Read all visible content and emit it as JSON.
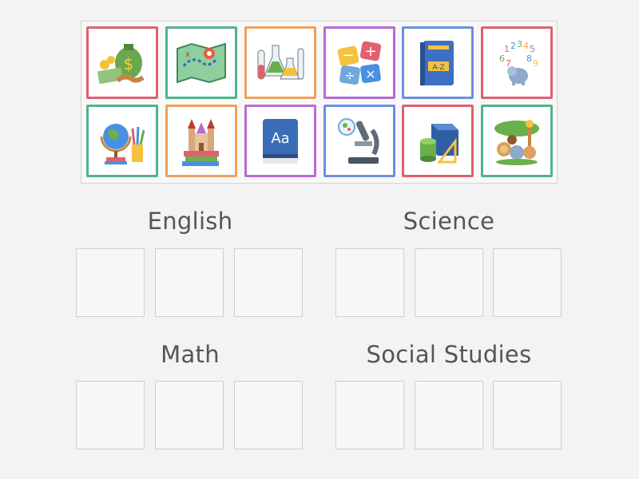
{
  "game": {
    "cards": [
      {
        "icon": "money-handshake-icon",
        "border": "#e06070"
      },
      {
        "icon": "treasure-map-icon",
        "border": "#4fb58a"
      },
      {
        "icon": "lab-flasks-icon",
        "border": "#f0a05a"
      },
      {
        "icon": "math-operators-icon",
        "border": "#b86ad6"
      },
      {
        "icon": "dictionary-book-icon",
        "border": "#6a8fe0"
      },
      {
        "icon": "numbers-elephant-icon",
        "border": "#e06070"
      },
      {
        "icon": "globe-pencils-icon",
        "border": "#4fb58a"
      },
      {
        "icon": "book-castle-icon",
        "border": "#f0a05a"
      },
      {
        "icon": "aa-book-icon",
        "border": "#b86ad6"
      },
      {
        "icon": "microscope-icon",
        "border": "#6a8fe0"
      },
      {
        "icon": "geometry-shapes-icon",
        "border": "#e06070"
      },
      {
        "icon": "jungle-animals-icon",
        "border": "#4fb58a"
      }
    ],
    "categories": [
      {
        "label": "English"
      },
      {
        "label": "Science"
      },
      {
        "label": "Math"
      },
      {
        "label": "Social Studies"
      }
    ]
  }
}
